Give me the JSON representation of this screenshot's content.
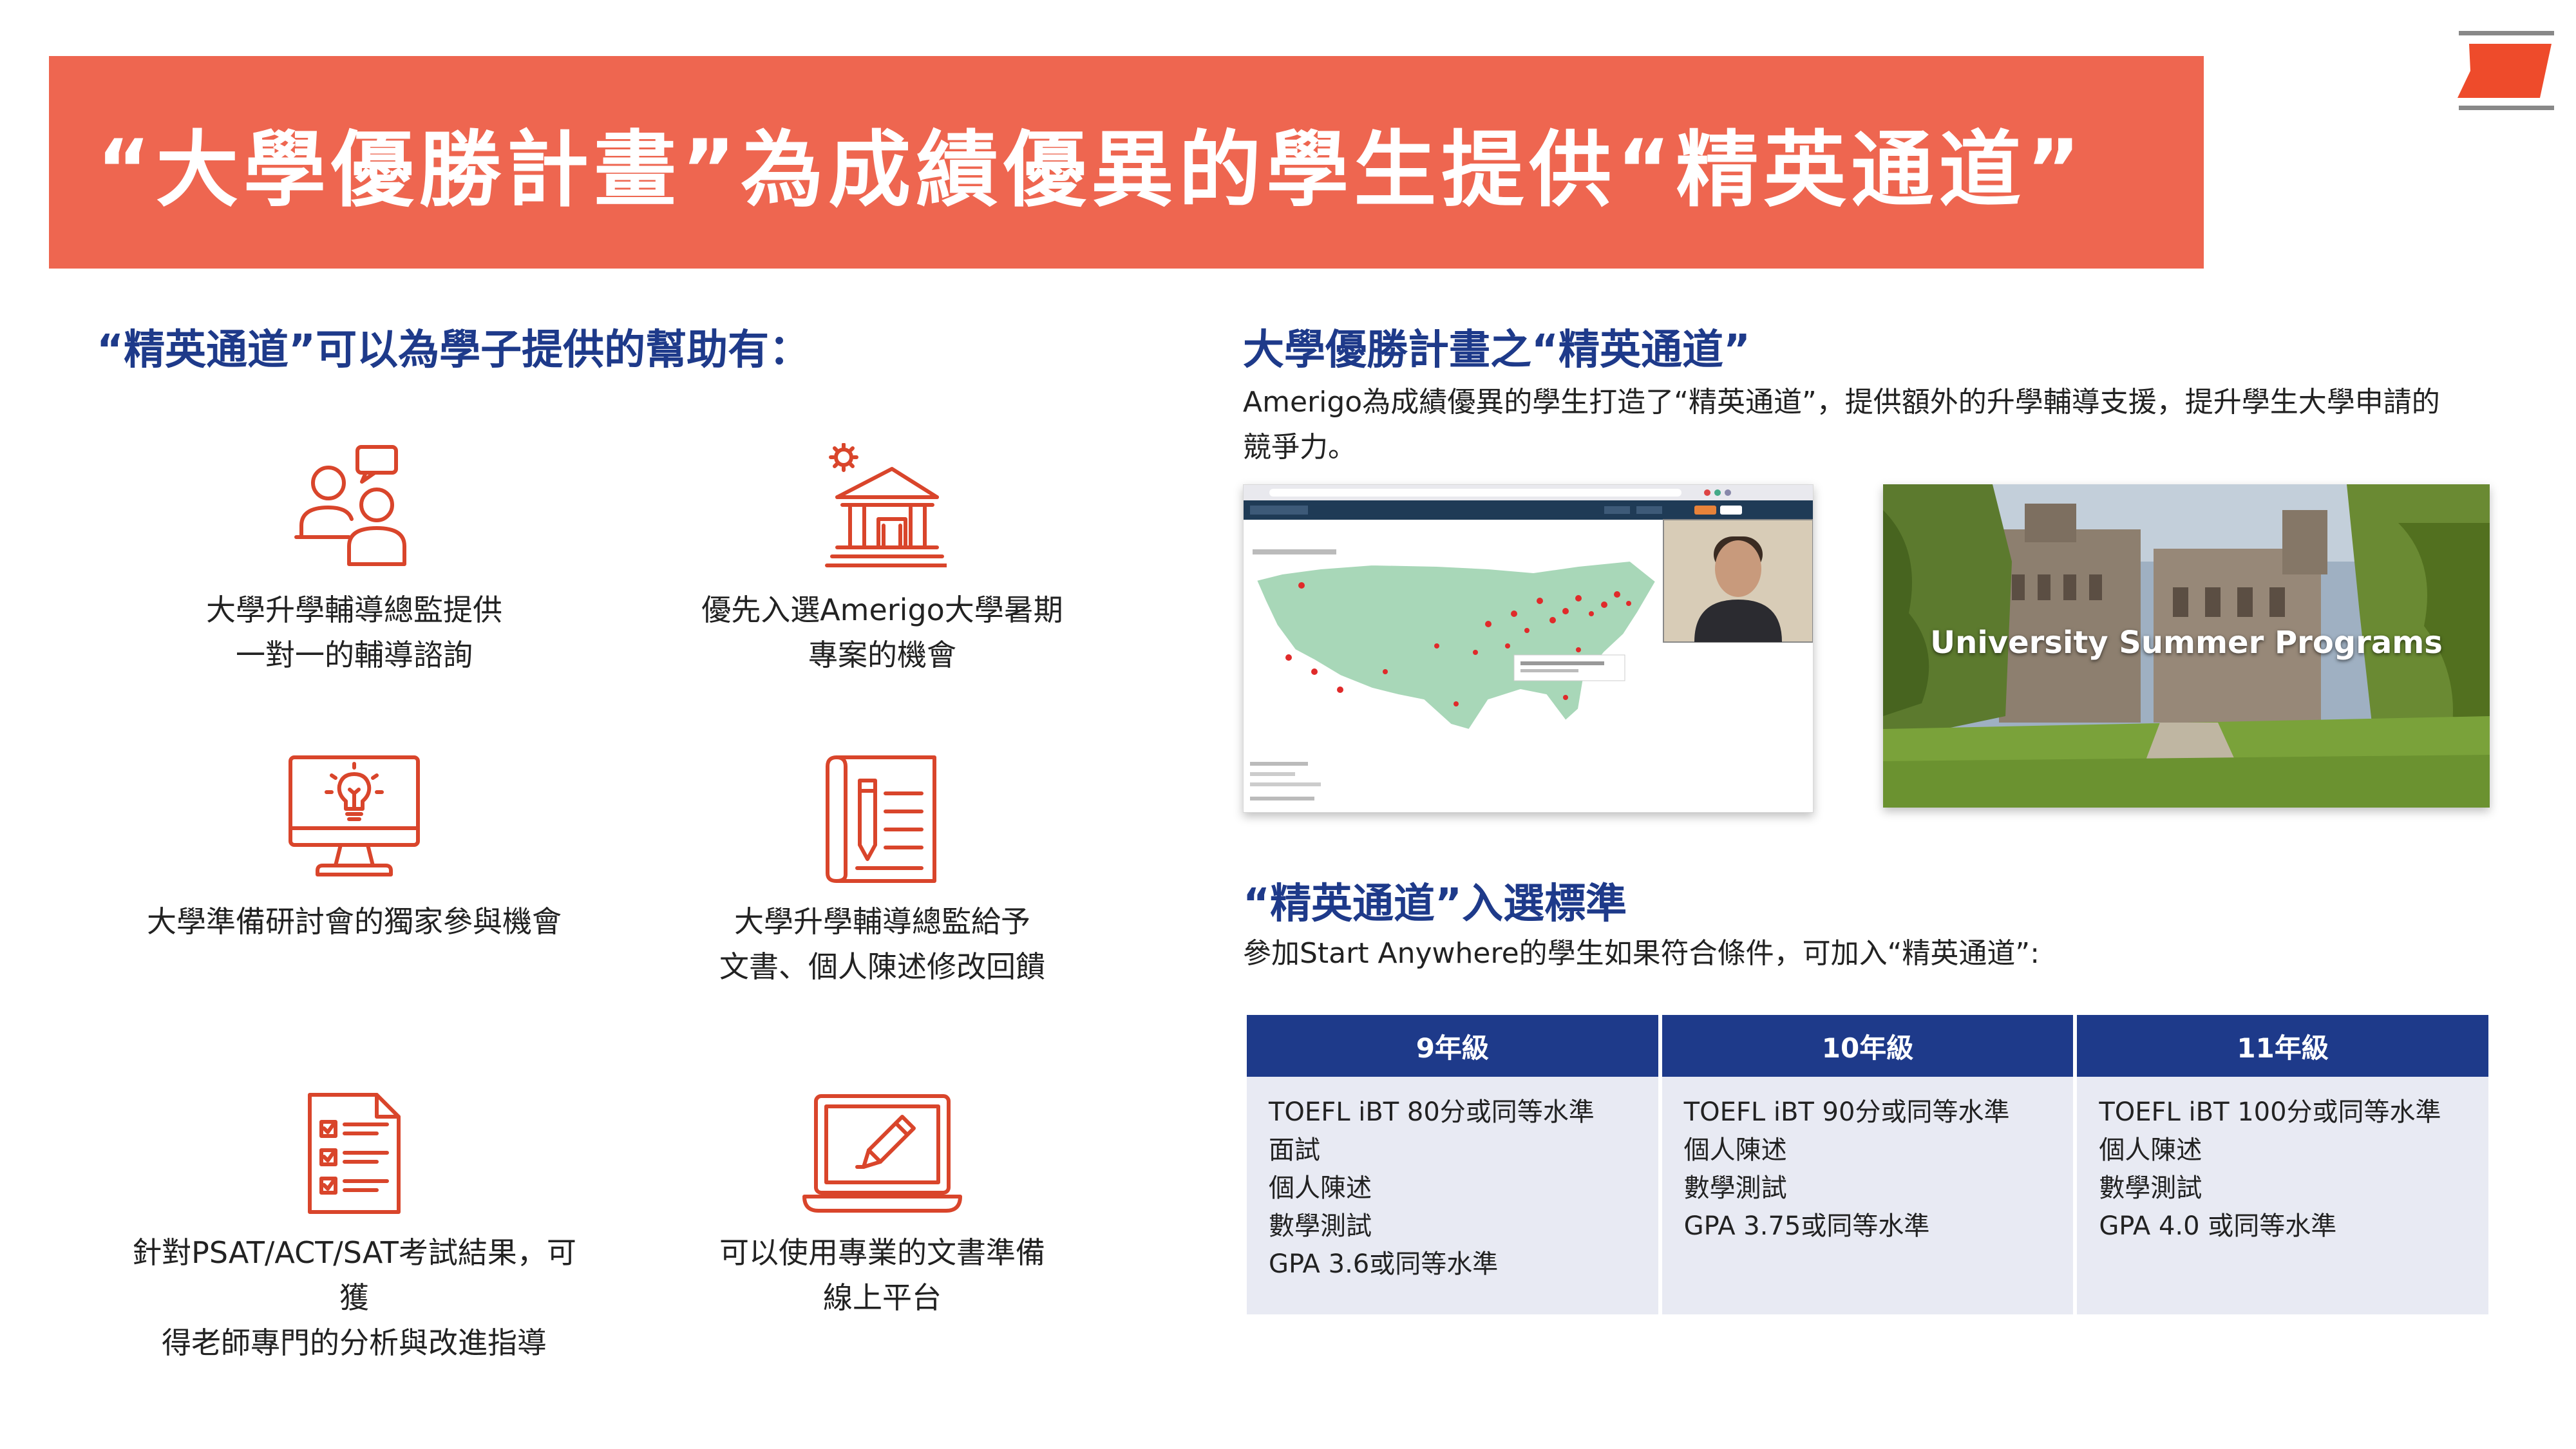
{
  "header": {
    "title": "“大學優勝計畫”為成績優異的學生提供“精英通道”",
    "accent_color": "#EE6650"
  },
  "left": {
    "heading": "“精英通道”可以為學子提供的幫助有：",
    "benefits": [
      {
        "icon": "consultation-icon",
        "caption": "大學升學輔導總監提供\n一對一的輔導諮詢"
      },
      {
        "icon": "university-building-icon",
        "caption": "優先入選Amerigo大學暑期\n專案的機會"
      },
      {
        "icon": "monitor-lightbulb-icon",
        "caption": "大學準備研討會的獨家參與機會"
      },
      {
        "icon": "document-pencil-icon",
        "caption": "大學升學輔導總監給予\n文書、個人陳述修改回饋"
      },
      {
        "icon": "checklist-icon",
        "caption": "針對PSAT/ACT/SAT考試結果，可獲\n得老師專門的分析與改進指導"
      },
      {
        "icon": "laptop-pen-icon",
        "caption": "可以使用專業的文書準備\n線上平台"
      }
    ]
  },
  "right": {
    "heading1": "大學優勝計畫之“精英通道”",
    "para1": "Amerigo為成績優異的學生打造了“精英通道”，提供額外的升學輔導支援，提升學生大學申請的競爭力。",
    "image2_caption": "University Summer Programs",
    "heading2": "“精英通道”入選標準",
    "para2": "參加Start Anywhere的學生如果符合條件，可加入“精英通道”:",
    "table": {
      "headers": [
        "9年級",
        "10年級",
        "11年級"
      ],
      "columns": [
        [
          "TOEFL iBT 80分或同等水準",
          "面試",
          "個人陳述",
          "數學測試",
          "GPA 3.6或同等水準"
        ],
        [
          "TOEFL iBT 90分或同等水準",
          "個人陳述",
          "數學測試",
          "GPA 3.75或同等水準"
        ],
        [
          "TOEFL iBT 100分或同等水準",
          "個人陳述",
          "數學測試",
          "GPA 4.0 或同等水準"
        ]
      ],
      "header_color": "#1E3A8A",
      "cell_color": "#E8EAF3"
    }
  }
}
